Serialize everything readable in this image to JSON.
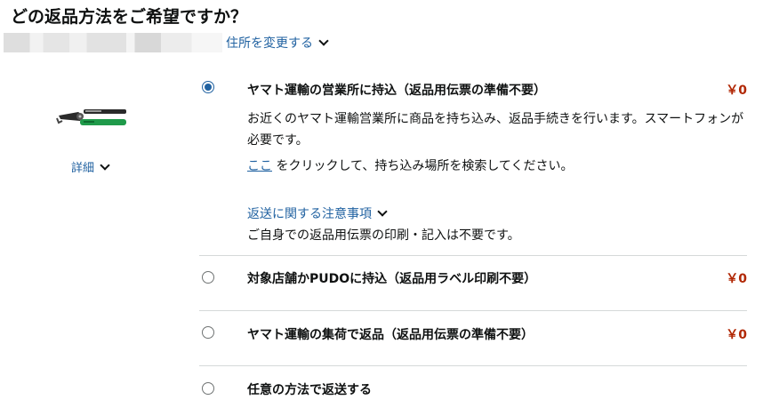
{
  "title": "どの返品方法をご希望ですか？",
  "address": {
    "change_label": "住所を変更する"
  },
  "item": {
    "details_label": "詳細"
  },
  "options": [
    {
      "title": "ヤマト運輸の営業所に持込（返品用伝票の準備不要）",
      "price": "￥0",
      "selected": true,
      "description": "お近くのヤマト運輸営業所に商品を持ち込み、返品手続きを行います。スマートフォンが必要です。",
      "search_link": "ここ",
      "search_text": " をクリックして、持ち込み場所を検索してください。",
      "notes_label": "返送に関する注意事項",
      "note": "ご自身での返品用伝票の印刷・記入は不要です。"
    },
    {
      "title": "対象店舗かPUDOに持込（返品用ラベル印刷不要）",
      "price": "￥0",
      "selected": false
    },
    {
      "title": "ヤマト運輸の集荷で返品（返品用伝票の準備不要）",
      "price": "￥0",
      "selected": false
    },
    {
      "title": "任意の方法で返送する",
      "selected": false
    }
  ],
  "colors": {
    "link": "#2162a1",
    "price": "#b12704",
    "text": "#0f1111",
    "divider": "#d5d9d9"
  }
}
